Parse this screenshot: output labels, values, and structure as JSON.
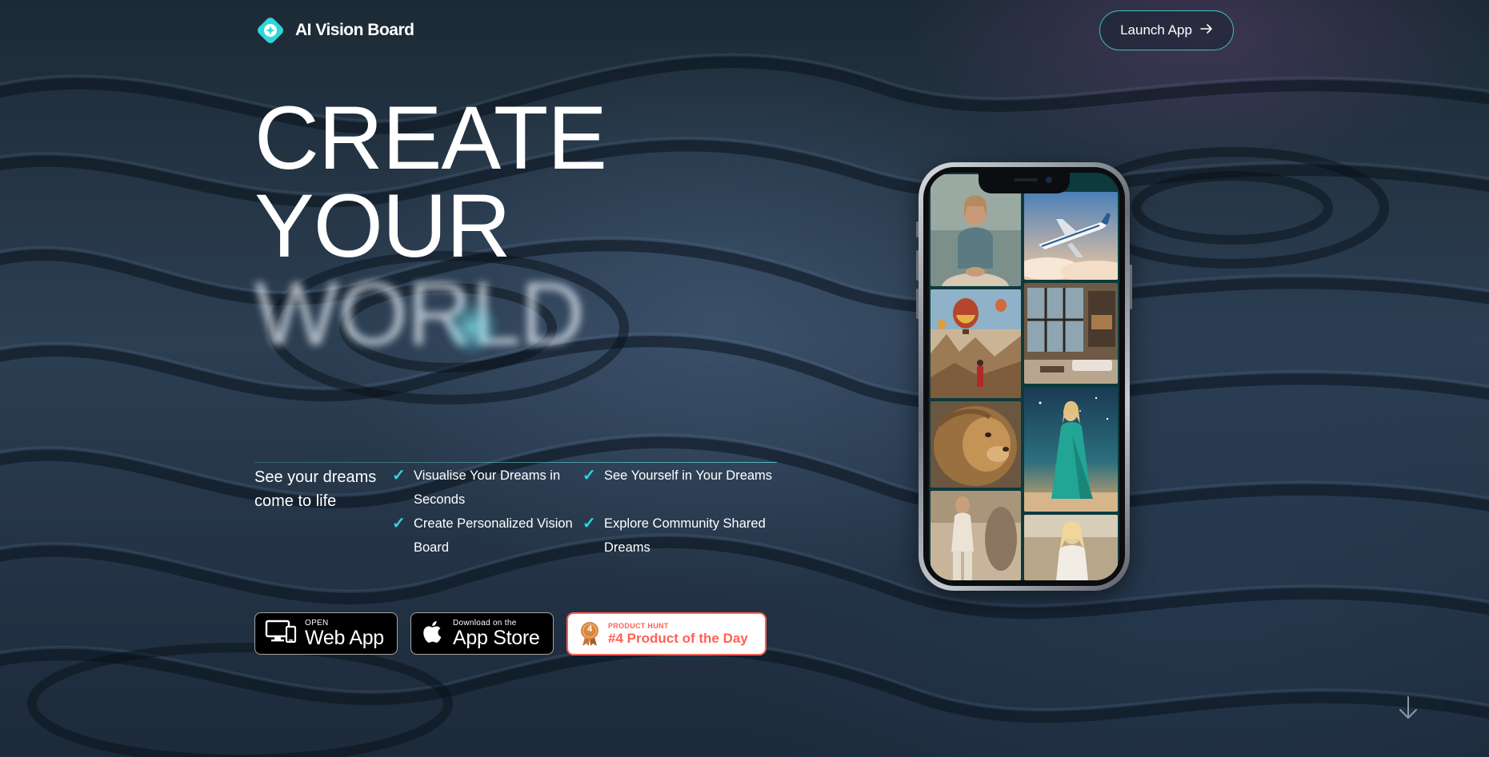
{
  "brand": {
    "name": "AI Vision Board",
    "accent": "#2fd6d9"
  },
  "header": {
    "launch_label": "Launch App"
  },
  "hero": {
    "line1": "CREATE",
    "line2": "YOUR",
    "line3": "WORLD"
  },
  "intro": {
    "tagline": "See your dreams come to life"
  },
  "features": [
    "Visualise Your Dreams in Seconds",
    "See Yourself in Your Dreams",
    "Create Personalized Vision Board",
    "Explore Community Shared Dreams"
  ],
  "badges": {
    "webapp": {
      "small": "OPEN",
      "big": "Web App"
    },
    "appstore": {
      "small": "Download on the",
      "big": "App Store"
    },
    "producthunt": {
      "small": "PRODUCT HUNT",
      "big": "#4 Product of the Day",
      "rank": "4",
      "color": "#ff6154"
    }
  },
  "phone_tiles": [
    {
      "subject": "woman meditating",
      "icon": "person"
    },
    {
      "subject": "private jet above clouds",
      "icon": "jet"
    },
    {
      "subject": "hot air balloons over canyon",
      "icon": "balloon"
    },
    {
      "subject": "luxury loft interior",
      "icon": "house"
    },
    {
      "subject": "lion",
      "icon": "lion"
    },
    {
      "subject": "woman in teal gown on beach",
      "icon": "person"
    },
    {
      "subject": "woman in white outfit",
      "icon": "person"
    },
    {
      "subject": "blonde woman in field",
      "icon": "person"
    }
  ]
}
